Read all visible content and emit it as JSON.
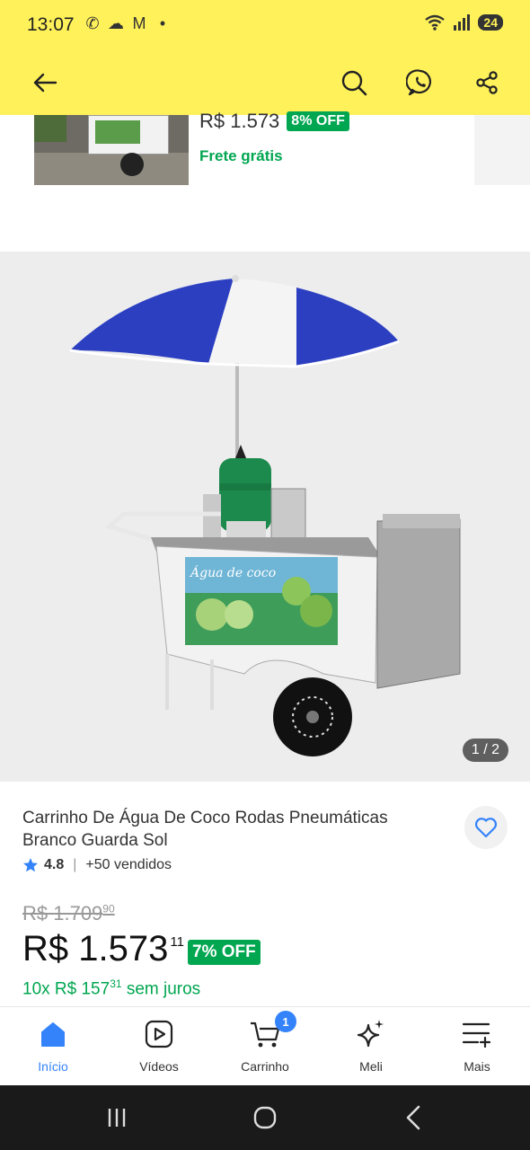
{
  "status": {
    "time": "13:07",
    "battery": "24"
  },
  "related": {
    "price": "R$ 1.573",
    "discount": "8% OFF",
    "shipping": "Frete grátis"
  },
  "gallery": {
    "counter": "1 / 2",
    "sign_text": "Água de coco"
  },
  "product": {
    "title": "Carrinho De Água De Coco Rodas Pneumáticas Branco Guarda Sol",
    "rating": "4.8",
    "sold": "+50 vendidos",
    "original_price": "R$ 1.709",
    "original_cents": "90",
    "price": "R$ 1.573",
    "price_cents": "11",
    "discount": "7% OFF",
    "installments_prefix": "10x R$ 157",
    "installments_cents": "31",
    "installments_suffix": "sem juros"
  },
  "nav": {
    "items": [
      {
        "label": "Início",
        "icon": "home-icon"
      },
      {
        "label": "Vídeos",
        "icon": "video-icon"
      },
      {
        "label": "Carrinho",
        "icon": "cart-icon",
        "badge": "1"
      },
      {
        "label": "Meli",
        "icon": "sparkle-icon"
      },
      {
        "label": "Mais",
        "icon": "menu-plus-icon"
      }
    ]
  },
  "colors": {
    "header_bg": "#fff159",
    "accent": "#3483fa",
    "green": "#00a650"
  }
}
